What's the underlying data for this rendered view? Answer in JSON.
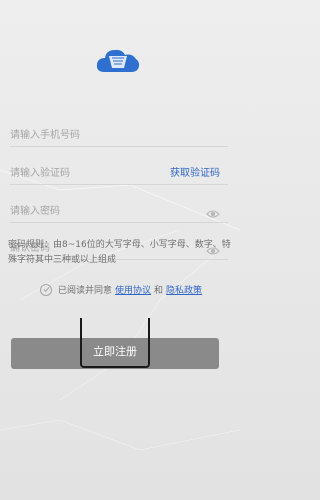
{
  "form": {
    "phone_placeholder": "请输入手机号码",
    "code_placeholder": "请输入验证码",
    "get_code_label": "获取验证码",
    "password_placeholder": "请输入密码",
    "confirm_placeholder": "确认密码"
  },
  "rules": {
    "text": "密码规则：由8~16位的大写字母、小写字母、数字、特殊字符其中三种或以上组成"
  },
  "agreement": {
    "prefix": "已阅读并同意",
    "terms_label": "使用协议",
    "and": "和",
    "privacy_label": "隐私政策"
  },
  "submit": {
    "label": "立即注册"
  },
  "colors": {
    "link": "#2f67c9",
    "button": "#8a8a8a",
    "background": "#ebebeb"
  },
  "icons": [
    "cloud-logo-icon",
    "eye-icon",
    "check-circle-icon"
  ]
}
